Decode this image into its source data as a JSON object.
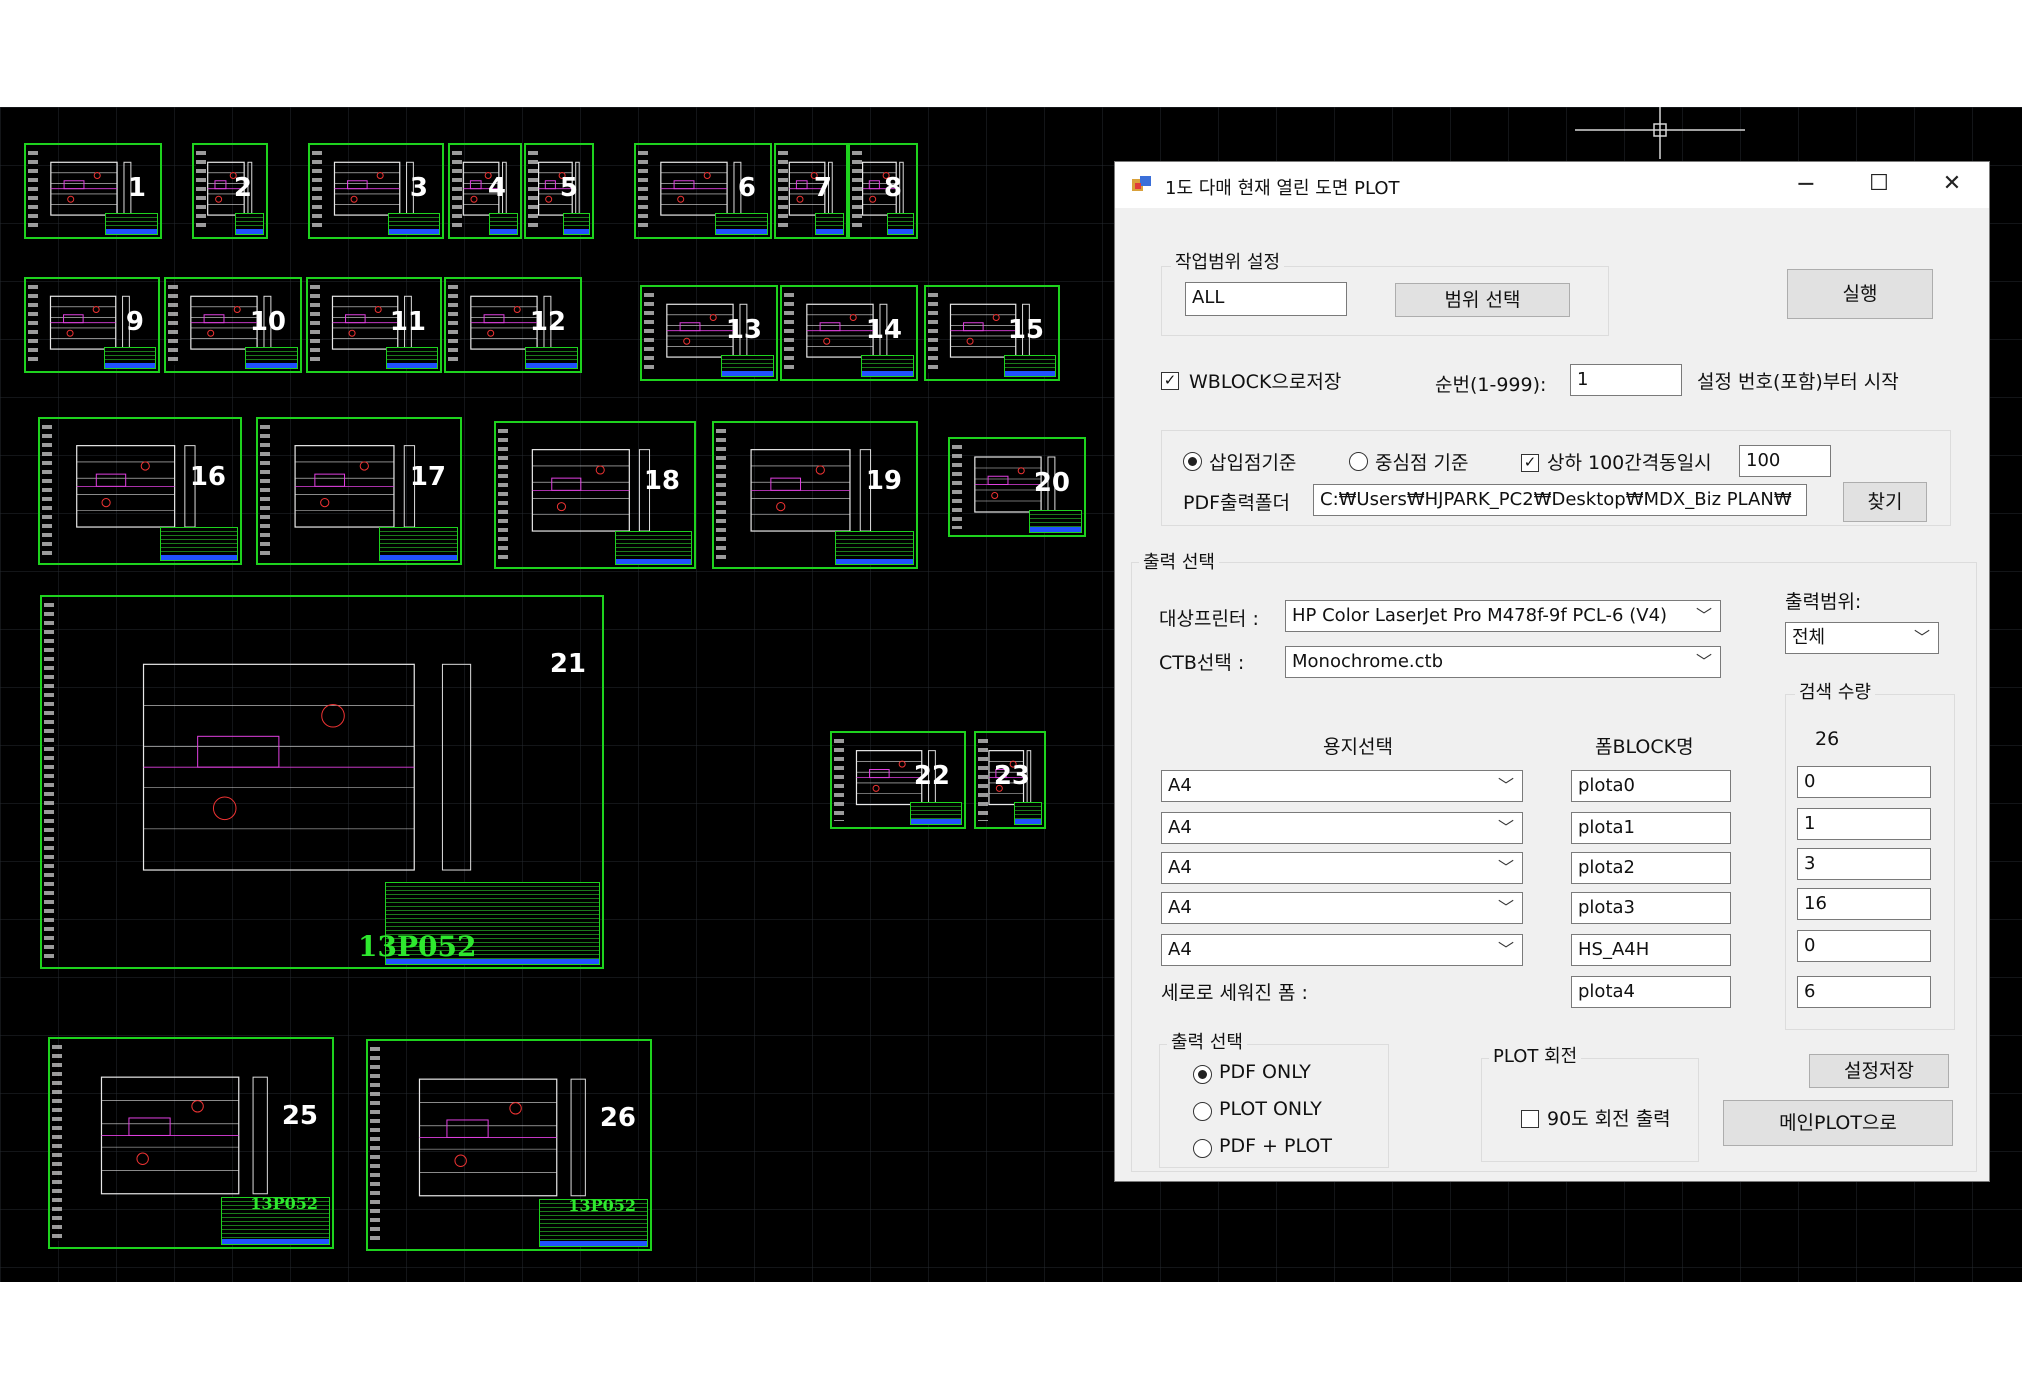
{
  "drawings": [
    {
      "num": "1"
    },
    {
      "num": "2"
    },
    {
      "num": "3"
    },
    {
      "num": "4"
    },
    {
      "num": "5"
    },
    {
      "num": "6"
    },
    {
      "num": "7"
    },
    {
      "num": "8"
    },
    {
      "num": "9"
    },
    {
      "num": "10"
    },
    {
      "num": "11"
    },
    {
      "num": "12"
    },
    {
      "num": "13"
    },
    {
      "num": "14"
    },
    {
      "num": "15"
    },
    {
      "num": "16"
    },
    {
      "num": "17"
    },
    {
      "num": "18"
    },
    {
      "num": "19"
    },
    {
      "num": "20"
    },
    {
      "num": "21"
    },
    {
      "num": "22"
    },
    {
      "num": "23"
    },
    {
      "num": "25"
    },
    {
      "num": "26"
    }
  ],
  "drawing_code": "13P052",
  "colors": {
    "cad_bg": "#000000",
    "frame": "#1ed21e",
    "dialog_bg": "#f0f0f0"
  },
  "dialog": {
    "title": "1도 다매 현재 열린 도면 PLOT",
    "window_buttons": {
      "minimize": "─",
      "maximize": "☐",
      "close": "✕"
    },
    "work_range": {
      "group_label": "작업범위 설정",
      "value": "ALL",
      "select_button": "범위 선택",
      "run_button": "실행"
    },
    "wblock": {
      "label": "WBLOCK으로저장",
      "checked": true
    },
    "seq": {
      "label": "순번(1-999):",
      "value": "1",
      "suffix": "설정 번호(포함)부터 시작"
    },
    "insert_point": {
      "label": "삽입점기준",
      "selected": true
    },
    "center_point": {
      "label": "중심점 기준",
      "selected": false
    },
    "gap": {
      "label": "상하 100간격동일시",
      "checked": true,
      "value": "100"
    },
    "pdf_folder": {
      "label": "PDF출력폴더",
      "value": "C:₩Users₩HJPARK_PC2₩Desktop₩MDX_Biz PLAN₩",
      "find_button": "찾기"
    },
    "output_select": {
      "group_label": "출력 선택",
      "printer_label": "대상프린터 :",
      "printer_value": "HP Color LaserJet Pro M478f-9f PCL-6 (V4)",
      "ctb_label": "CTB선택 :",
      "ctb_value": "Monochrome.ctb",
      "range_label": "출력범위:",
      "range_value": "전체",
      "search_group": "검색 수량",
      "search_total": "26",
      "paper_header": "용지선택",
      "form_header": "폼BLOCK명",
      "rows": [
        {
          "paper": "A4",
          "form": "plota0",
          "count": "0"
        },
        {
          "paper": "A4",
          "form": "plota1",
          "count": "1"
        },
        {
          "paper": "A4",
          "form": "plota2",
          "count": "3"
        },
        {
          "paper": "A4",
          "form": "plota3",
          "count": "16"
        },
        {
          "paper": "A4",
          "form": "HS_A4H",
          "count": "0"
        }
      ],
      "vertical_label": "세로로 세워진 폼 :",
      "vertical_form": "plota4",
      "vertical_count": "6"
    },
    "print_mode": {
      "group_label": "출력 선택",
      "options": [
        {
          "label": "PDF ONLY",
          "selected": true
        },
        {
          "label": "PLOT ONLY",
          "selected": false
        },
        {
          "label": "PDF + PLOT",
          "selected": false
        }
      ]
    },
    "rotate": {
      "group_label": "PLOT 회전",
      "label": "90도 회전 출력",
      "checked": false
    },
    "save_button": "설정저장",
    "main_button": "메인PLOT으로"
  }
}
